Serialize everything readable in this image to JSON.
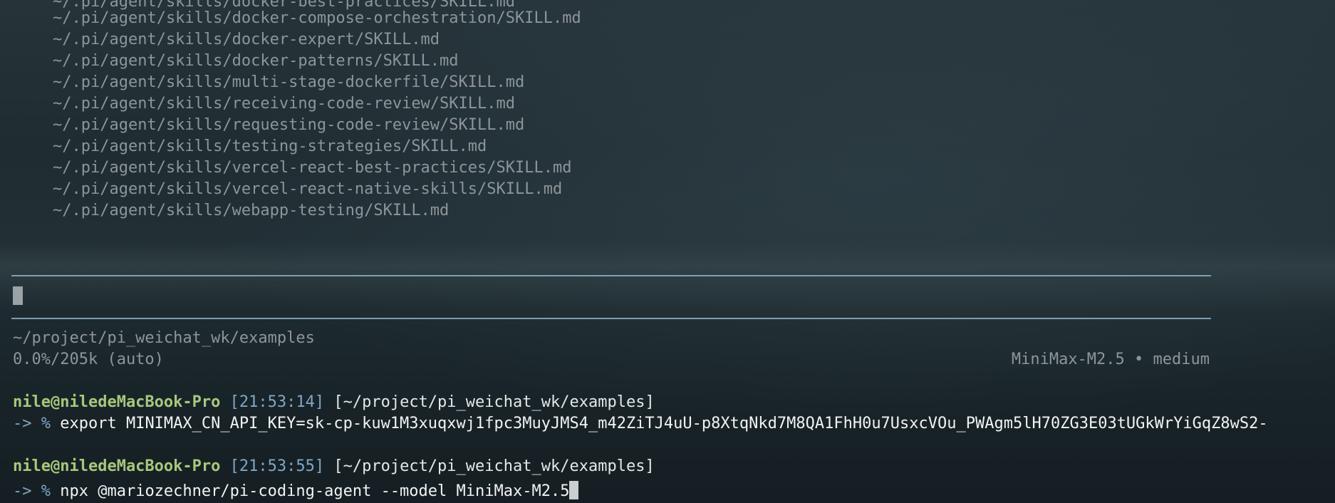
{
  "skills": [
    "~/.pi/agent/skills/docker-best-practices/SKILL.md",
    "~/.pi/agent/skills/docker-compose-orchestration/SKILL.md",
    "~/.pi/agent/skills/docker-expert/SKILL.md",
    "~/.pi/agent/skills/docker-patterns/SKILL.md",
    "~/.pi/agent/skills/multi-stage-dockerfile/SKILL.md",
    "~/.pi/agent/skills/receiving-code-review/SKILL.md",
    "~/.pi/agent/skills/requesting-code-review/SKILL.md",
    "~/.pi/agent/skills/testing-strategies/SKILL.md",
    "~/.pi/agent/skills/vercel-react-best-practices/SKILL.md",
    "~/.pi/agent/skills/vercel-react-native-skills/SKILL.md",
    "~/.pi/agent/skills/webapp-testing/SKILL.md"
  ],
  "footer": {
    "cwd": "~/project/pi_weichat_wk/examples",
    "context_usage": "0.0%/205k (auto)",
    "model_status": "MiniMax-M2.5 • medium"
  },
  "prompts": [
    {
      "user": "nile@niledeMacBook-Pro",
      "time": "[21:53:14]",
      "path": "[~/project/pi_weichat_wk/examples]",
      "arrow": "-> %",
      "command": "export MINIMAX_CN_API_KEY=sk-cp-kuw1M3xuqxwj1fpc3MuyJMS4_m42ZiTJ4uU-p8XtqNkd7M8QA1FhH0u7UsxcVOu_PWAgm5lH70ZG3E03tUGkWrYiGqZ8wS2-"
    },
    {
      "user": "nile@niledeMacBook-Pro",
      "time": "[21:53:55]",
      "path": "[~/project/pi_weichat_wk/examples]",
      "arrow": "-> %",
      "command": "npx @mariozechner/pi-coding-agent --model MiniMax-M2.5"
    }
  ],
  "colors": {
    "user": "#a7c77c",
    "time": "#7fa6c8",
    "rule": "#8eb0c8"
  }
}
